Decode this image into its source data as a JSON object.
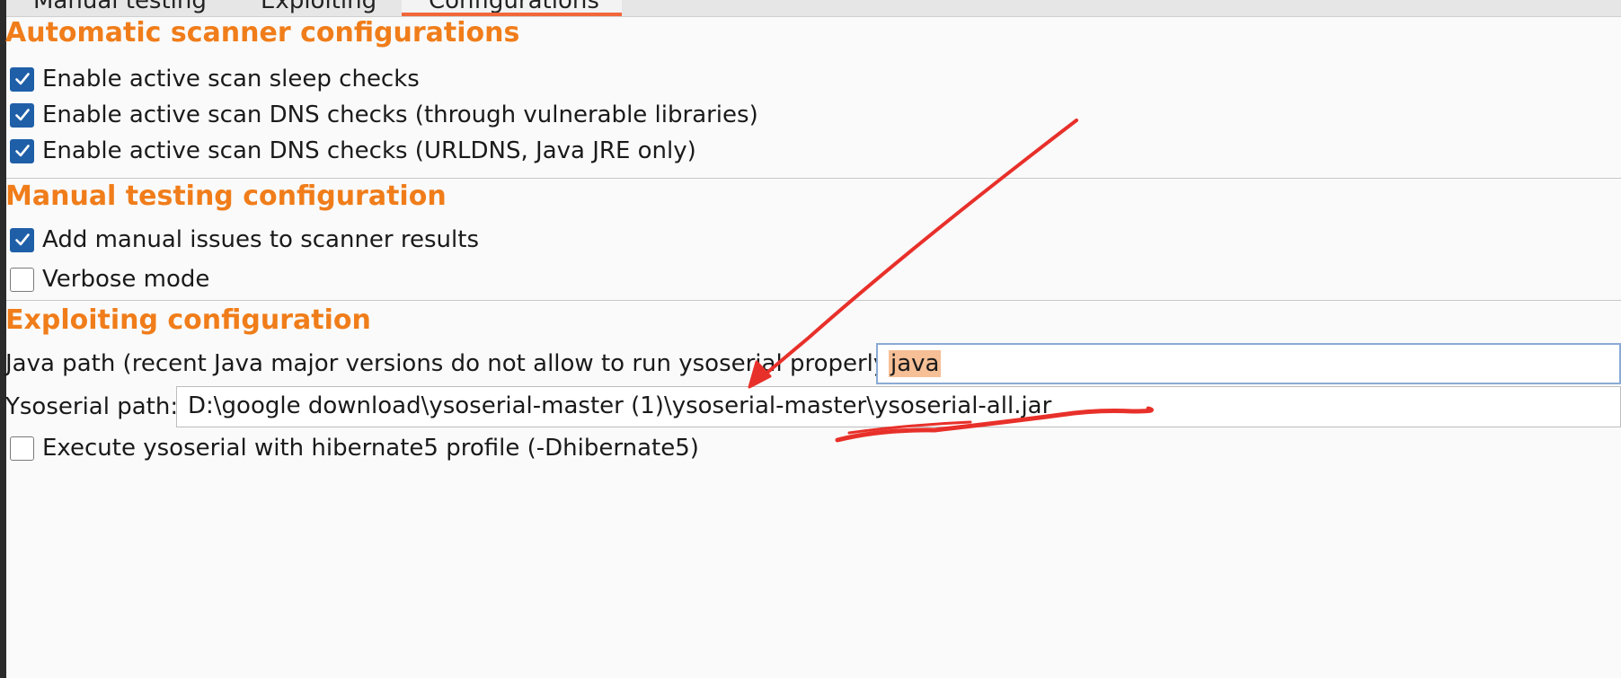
{
  "tabs": [
    {
      "label": "Manual testing"
    },
    {
      "label": "Exploiting"
    },
    {
      "label": "Configurations"
    }
  ],
  "scanner": {
    "title": "Automatic scanner configurations",
    "options": [
      {
        "label": "Enable active scan sleep checks",
        "checked": true
      },
      {
        "label": "Enable active scan DNS checks (through vulnerable libraries)",
        "checked": true
      },
      {
        "label": "Enable active scan DNS checks (URLDNS, Java JRE only)",
        "checked": true
      }
    ]
  },
  "manual": {
    "title": "Manual testing configuration",
    "options": [
      {
        "label": "Add manual issues to scanner results",
        "checked": true
      },
      {
        "label": "Verbose mode",
        "checked": false
      }
    ]
  },
  "exploiting": {
    "title": "Exploiting configuration",
    "java_path_label": "Java path (recent Java major versions do not allow to run ysoserial properly):",
    "java_path_value": "java",
    "ysoserial_label": "Ysoserial path:",
    "ysoserial_value": "D:\\google download\\ysoserial-master (1)\\ysoserial-master\\ysoserial-all.jar",
    "hibernate_option": {
      "label": "Execute ysoserial with hibernate5 profile (-Dhibernate5)",
      "checked": false
    }
  },
  "colors": {
    "accent_orange": "#f07d1a",
    "tab_underline": "#f2683a",
    "checkbox_blue": "#1f5fa8",
    "annotation_red": "#e8302a",
    "selection": "#f6bf96"
  },
  "icons": {
    "checked": "checkmark-icon",
    "annotation": "red-arrow-and-underline-markup"
  }
}
